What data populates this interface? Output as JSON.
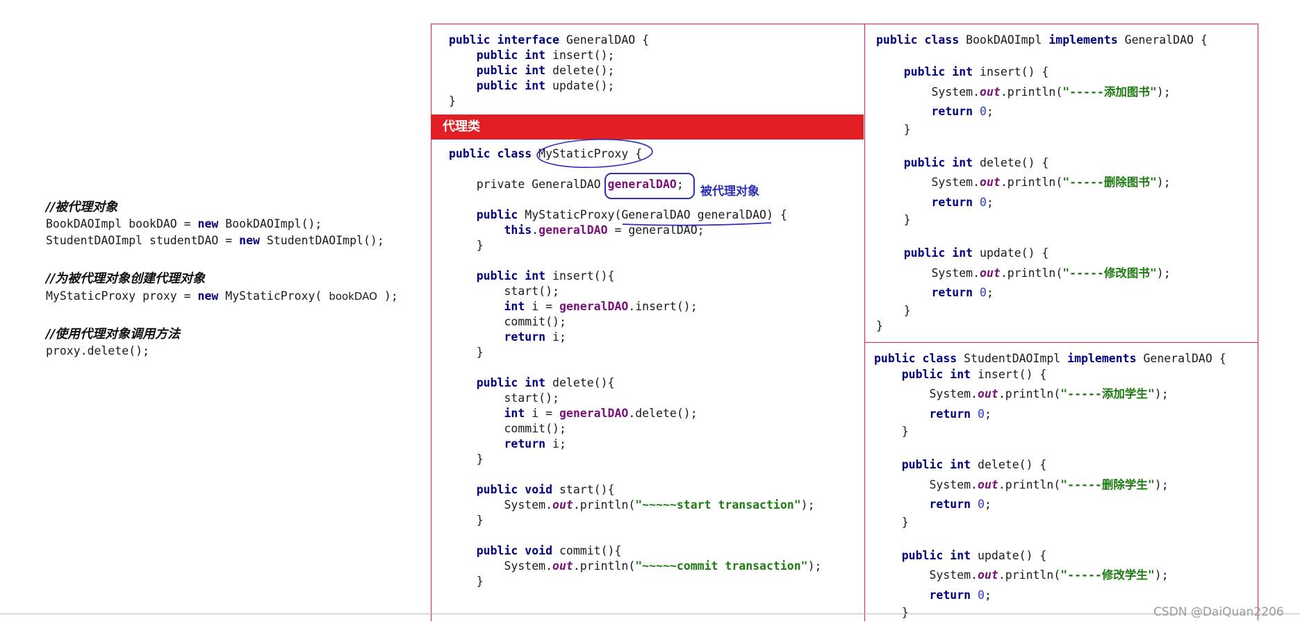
{
  "left": {
    "heading1": "//被代理对象",
    "line1_a": "BookDAOImpl bookDAO = ",
    "line1_kw": "new",
    "line1_b": " BookDAOImpl();",
    "line2_a": "StudentDAOImpl studentDAO = ",
    "line2_kw": "new",
    "line2_b": " StudentDAOImpl();",
    "heading2": "//为被代理对象创建代理对象",
    "line3_a": "MyStaticProxy proxy = ",
    "line3_kw": "new",
    "line3_b": " MyStaticProxy( ",
    "line3_arg": "bookDAO",
    "line3_c": " );",
    "heading3": "//使用代理对象调用方法",
    "line4": "proxy.delete();"
  },
  "interface_code": {
    "l1_kw": "public interface",
    "l1_rest": " GeneralDAO {",
    "l2_kw": "public int",
    "l2_rest": " insert();",
    "l3_kw": "public int",
    "l3_rest": " delete();",
    "l4_kw": "public int",
    "l4_rest": " update();",
    "l5": "}"
  },
  "proxy_band": "代理类",
  "proxy_code": {
    "class_kw": "public class",
    "class_name": " MyStaticProxy",
    "class_rest": " {",
    "private_kw": "private",
    "private_type": " GeneralDAO ",
    "private_field": "generalDAO",
    "private_end": ";",
    "annotation": "被代理对象",
    "ctor_kw": "public",
    "ctor_name": " MyStaticProxy(",
    "ctor_param": "GeneralDAO generalDAO",
    "ctor_end": ") {",
    "this_kw": "this",
    "this_dot": ".",
    "this_field": "generalDAO",
    "this_rest": " = generalDAO;",
    "close": "}",
    "insert_kw": "public int",
    "insert_rest": " insert(){",
    "start_call": "start();",
    "int_kw": "int",
    "i_assign": " i = ",
    "gd": "generalDAO",
    "insert_call": ".insert();",
    "commit_call": "commit();",
    "return_kw": "return",
    "return_rest": " i;",
    "delete_kw": "public int",
    "delete_rest": " delete(){",
    "delete_call": ".delete();",
    "start_kw": "public void",
    "start_rest": " start(){",
    "sys": "System.",
    "out": "out",
    "println": ".println(",
    "start_str": "\"~~~~~start transaction\"",
    "println_end": ");",
    "commit_kw": "public void",
    "commit_rest": " commit(){",
    "commit_str": "\"~~~~~commit transaction\""
  },
  "book_code": {
    "class_kw": "public class",
    "class_name": " BookDAOImpl ",
    "impl_kw": "implements",
    "impl_rest": " GeneralDAO {",
    "m1_kw": "public int",
    "m1_rest": " insert() {",
    "m1_str": "\"-----添加图书\"",
    "m2_kw": "public int",
    "m2_rest": " delete() {",
    "m2_str": "\"-----删除图书\"",
    "m3_kw": "public int",
    "m3_rest": " update() {",
    "m3_str": "\"-----修改图书\"",
    "sys": "System.",
    "out": "out",
    "println": ".println(",
    "println_end": ");",
    "return_kw": "return",
    "zero": "0",
    "semi": ";",
    "close": "}"
  },
  "student_code": {
    "class_kw": "public class",
    "class_name": " StudentDAOImpl ",
    "impl_kw": "implements",
    "impl_rest": " GeneralDAO {",
    "m1_kw": "public int",
    "m1_rest": " insert() {",
    "m1_str": "\"-----添加学生\"",
    "m2_kw": "public int",
    "m2_rest": " delete() {",
    "m2_str": "\"-----删除学生\"",
    "m3_kw": "public int",
    "m3_rest": " update() {",
    "m3_str": "\"-----修改学生\""
  },
  "watermark": "CSDN @DaiQuan2206",
  "colors": {
    "keyword": "#000080",
    "field": "#7a0f7a",
    "string": "#1e7d12",
    "number": "#2b3ad0",
    "box_border": "#e8232e",
    "band": "#e01e24",
    "annotation": "#2c2fb8"
  }
}
